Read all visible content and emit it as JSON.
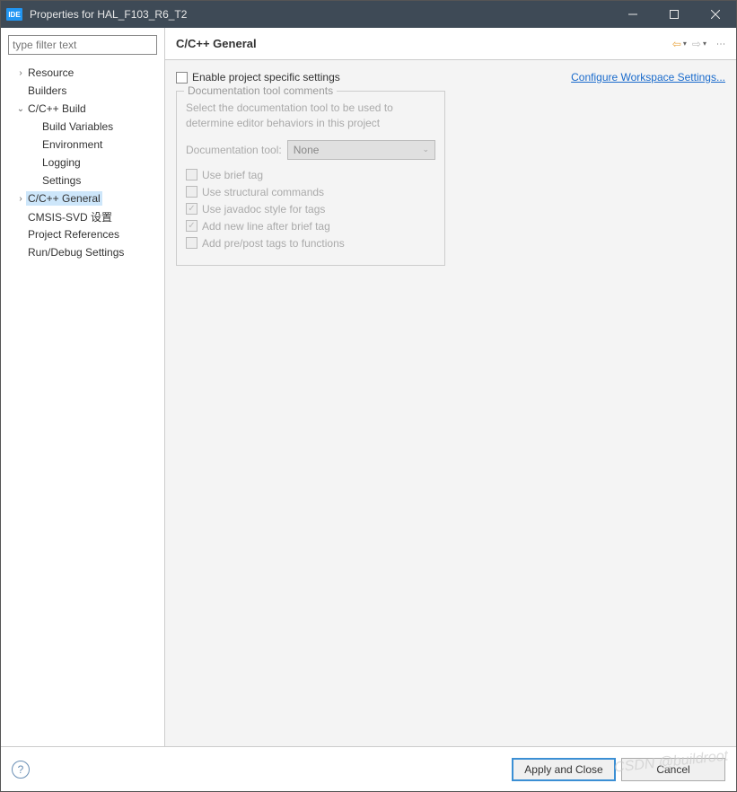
{
  "titlebar": {
    "title": "Properties for HAL_F103_R6_T2",
    "ide": "IDE"
  },
  "filter": {
    "placeholder": "type filter text"
  },
  "tree": {
    "items": [
      {
        "label": "Resource",
        "indent": 0,
        "exp": "›"
      },
      {
        "label": "Builders",
        "indent": 0,
        "exp": ""
      },
      {
        "label": "C/C++ Build",
        "indent": 0,
        "exp": "⌄"
      },
      {
        "label": "Build Variables",
        "indent": 1,
        "exp": ""
      },
      {
        "label": "Environment",
        "indent": 1,
        "exp": ""
      },
      {
        "label": "Logging",
        "indent": 1,
        "exp": ""
      },
      {
        "label": "Settings",
        "indent": 1,
        "exp": ""
      },
      {
        "label": "C/C++ General",
        "indent": 0,
        "exp": "›",
        "selected": true
      },
      {
        "label": "CMSIS-SVD 设置",
        "indent": 0,
        "exp": ""
      },
      {
        "label": "Project References",
        "indent": 0,
        "exp": ""
      },
      {
        "label": "Run/Debug Settings",
        "indent": 0,
        "exp": ""
      }
    ]
  },
  "header": {
    "title": "C/C++ General"
  },
  "body": {
    "enable_label": "Enable project specific settings",
    "config_link": "Configure Workspace Settings...",
    "group_title": "Documentation tool comments",
    "group_desc": "Select the documentation tool to be used to determine editor behaviors in this project",
    "doc_tool_label": "Documentation tool:",
    "doc_tool_value": "None",
    "opts": [
      {
        "label": "Use brief tag",
        "checked": false
      },
      {
        "label": "Use structural commands",
        "checked": false
      },
      {
        "label": "Use javadoc style for tags",
        "checked": true
      },
      {
        "label": "Add new line after brief tag",
        "checked": true
      },
      {
        "label": "Add pre/post tags to functions",
        "checked": false
      }
    ]
  },
  "footer": {
    "apply": "Apply and Close",
    "cancel": "Cancel"
  },
  "watermark": "CSDN @buildroot"
}
